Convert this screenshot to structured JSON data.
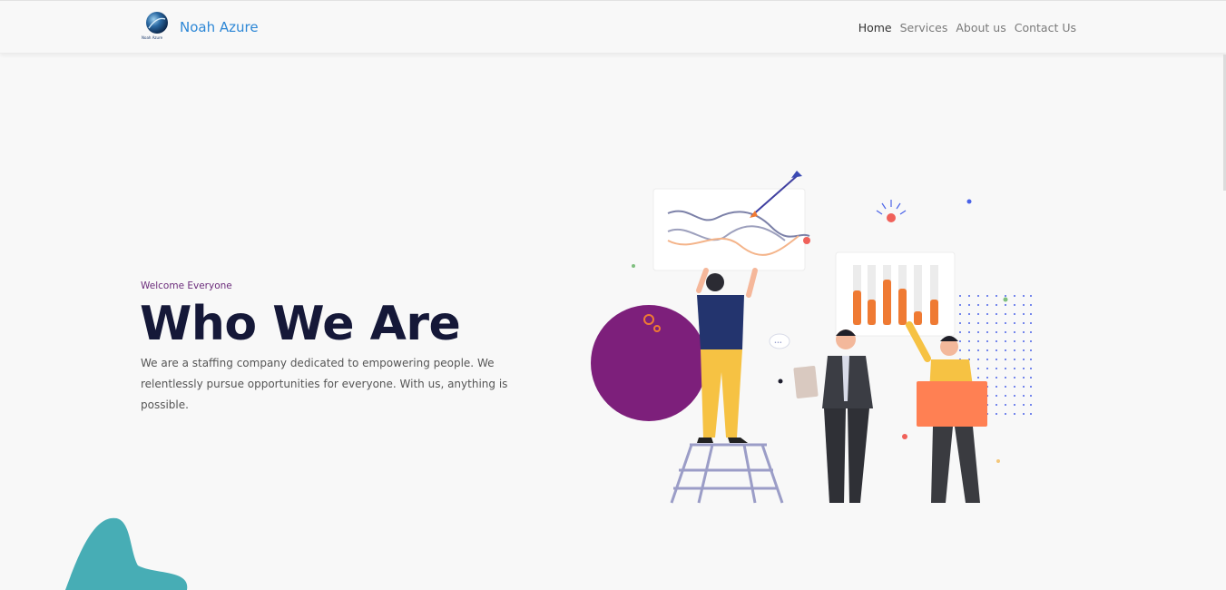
{
  "header": {
    "brand_name": "Noah Azure",
    "logo_caption": "Noah Azure",
    "nav": [
      {
        "label": "Home",
        "active": true
      },
      {
        "label": "Services",
        "active": false
      },
      {
        "label": "About us",
        "active": false
      },
      {
        "label": "Contact Us",
        "active": false
      }
    ]
  },
  "hero": {
    "eyebrow": "Welcome Everyone",
    "title": "Who We Are",
    "description": "We are a staffing company dedicated to empowering people. We relentlessly pursue opportunities for everyone. With us, anything is possible."
  },
  "colors": {
    "brand_blue": "#2d87d6",
    "title_navy": "#151838",
    "eyebrow_purple": "#6b2c7b",
    "purple_circle": "#7d1f7b",
    "teal_blob": "#47adb5",
    "orange_accent": "#ef7a33"
  }
}
